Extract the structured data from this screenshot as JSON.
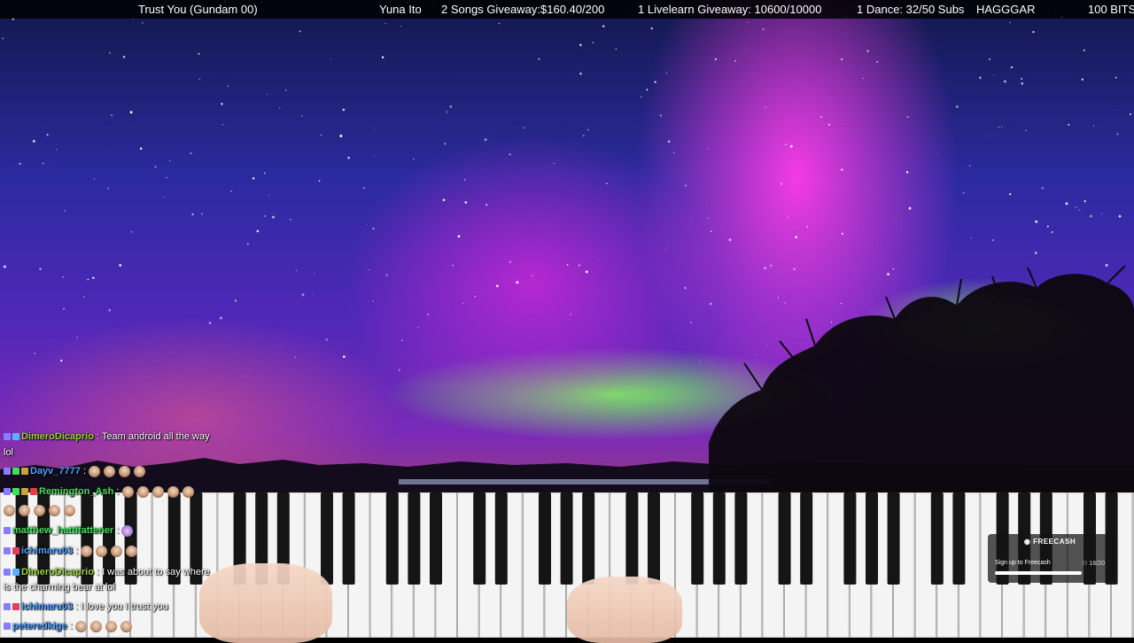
{
  "topbar": {
    "song": "Trust You (Gundam 00)",
    "artist": "Yuna Ito",
    "songs_giveaway": "2 Songs Giveaway:$160.40/200",
    "livelearn_giveaway": "1 Livelearn Giveaway: 10600/10000",
    "dance": "1 Dance: 32/50 Subs",
    "supporter": "HAGGGAR",
    "bits": "100 BITS"
  },
  "chat": {
    "messages": [
      {
        "user": "DimeroDicaprio",
        "sep": " : ",
        "text": "Team android all the way"
      },
      {
        "user": "",
        "sep": "",
        "text": "lol"
      },
      {
        "user": "Dayv_7777",
        "sep": " :",
        "text": ""
      },
      {
        "user": "Remington_Ash",
        "sep": " :",
        "text": ""
      },
      {
        "user": "matthew_hattifattener",
        "sep": " :",
        "text": ""
      },
      {
        "user": "ichimaru03",
        "sep": " :",
        "text": ""
      },
      {
        "user": "DimeroDicaprio",
        "sep": " : ",
        "text": "I was about to say where"
      },
      {
        "user": "",
        "sep": "",
        "text": "is the charming bear at lol"
      },
      {
        "user": "ichimaru03",
        "sep": " : ",
        "text": "I love you I trust you"
      },
      {
        "user": "peteredkige",
        "sep": " :",
        "text": ""
      }
    ]
  },
  "ad": {
    "brand": "FREECASH",
    "cta": "Sign up to Freecash",
    "counter": "16/20"
  },
  "colors": {
    "topbar_bg": "#000000",
    "user_green": "#3fe05a",
    "user_blue": "#4aa0ff",
    "user_lime": "#9ad23a"
  }
}
